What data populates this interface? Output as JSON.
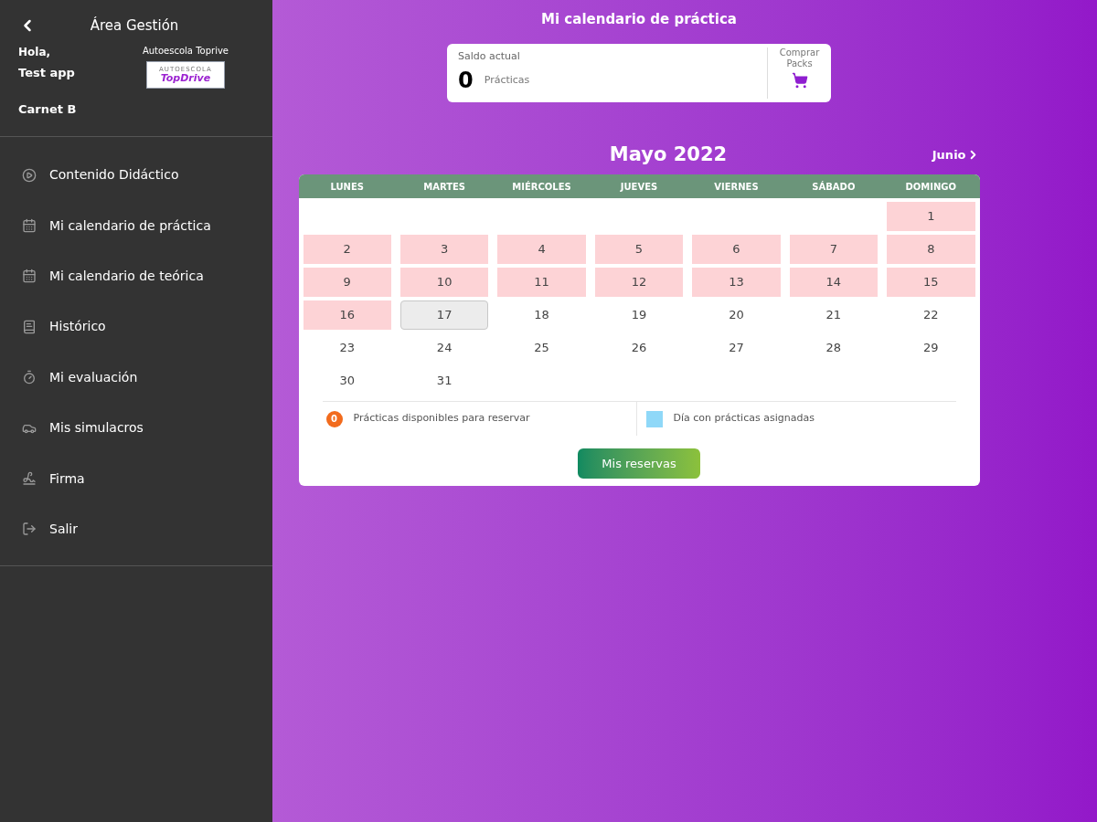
{
  "sidebar": {
    "title": "Área Gestión",
    "greeting": "Hola,",
    "user": "Test app",
    "school": "Autoescola Toprive",
    "logo": {
      "top": "AUTOESCOLA",
      "brand": "TopDrive"
    },
    "license": "Carnet B",
    "items": [
      {
        "label": "Contenido Didáctico"
      },
      {
        "label": "Mi calendario de práctica"
      },
      {
        "label": "Mi calendario de teórica"
      },
      {
        "label": "Histórico"
      },
      {
        "label": "Mi evaluación"
      },
      {
        "label": "Mis simulacros"
      },
      {
        "label": "Firma"
      },
      {
        "label": "Salir"
      }
    ]
  },
  "page_title": "Mi calendario de práctica",
  "balance": {
    "label": "Saldo actual",
    "count": "0",
    "unit": "Prácticas",
    "buy": "Comprar Packs"
  },
  "calendar": {
    "month": "Mayo 2022",
    "next": "Junio",
    "weekdays": [
      "LUNES",
      "MARTES",
      "MIÉRCOLES",
      "JUEVES",
      "VIERNES",
      "SÁBADO",
      "DOMINGO"
    ],
    "weeks": [
      [
        {
          "day": "1",
          "kind": "past"
        }
      ],
      [
        {
          "day": "2",
          "kind": "past"
        },
        {
          "day": "3",
          "kind": "past"
        },
        {
          "day": "4",
          "kind": "past"
        },
        {
          "day": "5",
          "kind": "past"
        },
        {
          "day": "6",
          "kind": "past"
        },
        {
          "day": "7",
          "kind": "past"
        },
        {
          "day": "8",
          "kind": "past"
        }
      ],
      [
        {
          "day": "9",
          "kind": "past"
        },
        {
          "day": "10",
          "kind": "past"
        },
        {
          "day": "11",
          "kind": "past"
        },
        {
          "day": "12",
          "kind": "past"
        },
        {
          "day": "13",
          "kind": "past"
        },
        {
          "day": "14",
          "kind": "past"
        },
        {
          "day": "15",
          "kind": "past"
        }
      ],
      [
        {
          "day": "16",
          "kind": "past"
        },
        {
          "day": "17",
          "kind": "today"
        },
        {
          "day": "18",
          "kind": "future"
        },
        {
          "day": "19",
          "kind": "future"
        },
        {
          "day": "20",
          "kind": "future"
        },
        {
          "day": "21",
          "kind": "future"
        },
        {
          "day": "22",
          "kind": "future"
        }
      ],
      [
        {
          "day": "23",
          "kind": "future"
        },
        {
          "day": "24",
          "kind": "future"
        },
        {
          "day": "25",
          "kind": "future"
        },
        {
          "day": "26",
          "kind": "future"
        },
        {
          "day": "27",
          "kind": "future"
        },
        {
          "day": "28",
          "kind": "future"
        },
        {
          "day": "29",
          "kind": "future"
        }
      ],
      [
        {
          "day": "30",
          "kind": "future"
        },
        {
          "day": "31",
          "kind": "future"
        }
      ]
    ],
    "legend": [
      {
        "kind": "badge",
        "badge": "0",
        "label": "Prácticas disponibles para reservar",
        "color": "#f26b1d"
      },
      {
        "kind": "swatch",
        "label": "Día con prácticas asignadas",
        "color": "#8fd8f8"
      }
    ],
    "button": "Mis reservas"
  }
}
